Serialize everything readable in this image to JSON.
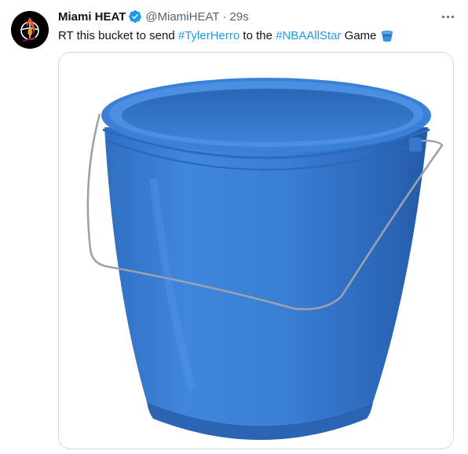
{
  "tweet": {
    "author_name": "Miami HEAT",
    "author_handle": "@MiamiHEAT",
    "separator": "·",
    "timestamp": "29s",
    "text_parts": {
      "prefix": "RT this bucket to send ",
      "hashtag1": "#TylerHerro",
      "middle": " to the ",
      "hashtag2": "#NBAAllStar",
      "suffix": " Game"
    },
    "verified": true,
    "icons": {
      "avatar": "miami-heat-logo",
      "verified": "verified-badge-icon",
      "more": "more-options-icon",
      "emoji": "bucket-emoji-icon"
    },
    "media": {
      "subject": "blue plastic bucket with metal wire handle"
    },
    "colors": {
      "link": "#1d9bf0",
      "secondary_text": "#536471",
      "bucket_blue": "#3b7fd4",
      "border": "#cfd9de"
    }
  }
}
